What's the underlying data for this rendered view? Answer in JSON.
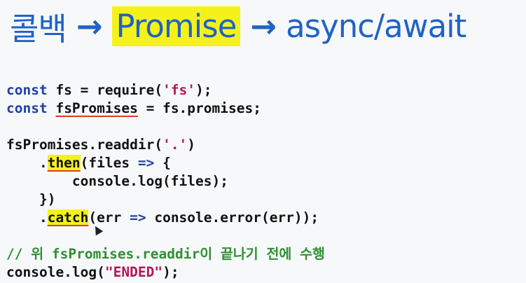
{
  "title": {
    "part1": "콜백",
    "arrow1": "→",
    "part2": "Promise",
    "arrow2": "→",
    "part3": "async/await"
  },
  "code": {
    "l1_kw": "const",
    "l1_rest_a": " fs = require(",
    "l1_str": "'fs'",
    "l1_rest_b": ");",
    "l2_kw": "const",
    "l2_var": "fsPromises",
    "l2_rest": " = fs.promises;",
    "l4_a": "fsPromises.readdir(",
    "l4_str": "'.'",
    "l4_b": ")",
    "l5_indent": "    .",
    "l5_method": "then",
    "l5_a": "(files ",
    "l5_op": "=>",
    "l5_b": " {",
    "l6": "        console.log(files);",
    "l7": "    })",
    "l8_indent": "    .",
    "l8_method": "catch",
    "l8_a": "(err ",
    "l8_op": "=>",
    "l8_b": " console.error(err));",
    "l10_comment": "// 위 fsPromises.readdir이 끝나기 전에 수행",
    "l11_a": "console.log(",
    "l11_str": "\"ENDED\"",
    "l11_b": ");"
  },
  "colors": {
    "title_blue": "#1f63c6",
    "highlight_yellow": "#f4f21a",
    "keyword_blue": "#1f3fa8",
    "string_pink": "#b2185a",
    "comment_green": "#2f8f31",
    "underline_red": "#e23a2a"
  }
}
